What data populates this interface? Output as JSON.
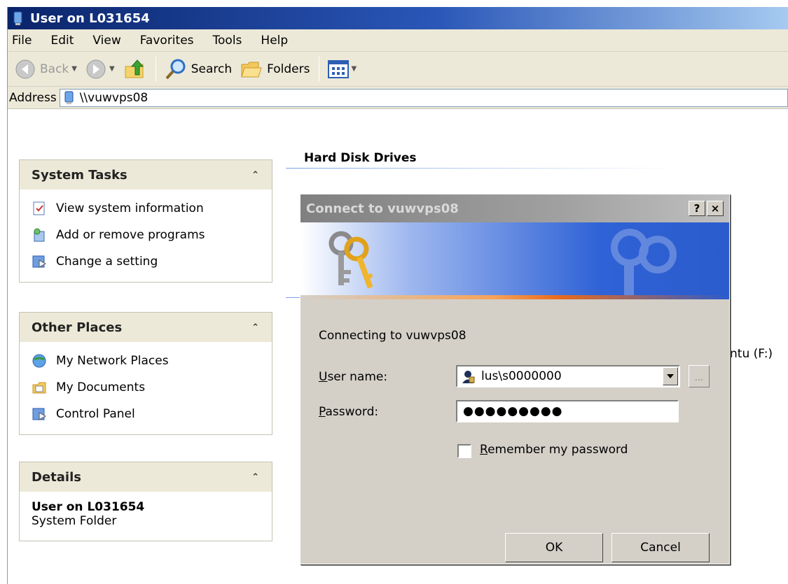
{
  "window": {
    "title": "User on L031654"
  },
  "menu": [
    "File",
    "Edit",
    "View",
    "Favorites",
    "Tools",
    "Help"
  ],
  "toolbar": {
    "back": "Back",
    "search": "Search",
    "folders": "Folders"
  },
  "address": {
    "label": "Address",
    "value": "\\\\vuwvps08"
  },
  "task_pane": {
    "system_tasks": {
      "title": "System Tasks",
      "items": [
        "View system information",
        "Add or remove programs",
        "Change a setting"
      ]
    },
    "other_places": {
      "title": "Other Places",
      "items": [
        "My Network Places",
        "My Documents",
        "Control Panel"
      ]
    },
    "details": {
      "title": "Details",
      "name": "User on L031654",
      "type": "System Folder"
    }
  },
  "content": {
    "section_heading": "Hard Disk Drives",
    "partial_item_label": "ntu (F:)"
  },
  "dialog": {
    "title": "Connect to vuwvps08",
    "help_button": "?",
    "close_button": "×",
    "connecting_text": "Connecting to vuwvps08",
    "user_label_u": "U",
    "user_label_rest": "ser name:",
    "user_value": "lus\\s0000000",
    "password_label_u": "P",
    "password_label_rest": "assword:",
    "password_value": "●●●●●●●●●",
    "remember_u": "R",
    "remember_rest": "emember my password",
    "remember_checked": false,
    "browse_label": "...",
    "ok_label": "OK",
    "cancel_label": "Cancel"
  },
  "colors": {
    "title_bar": "#0a246a",
    "inactive_title": "#808080",
    "banner_blue": "#2b5ccc",
    "banner_orange": "#e96b1c",
    "face": "#d4d0c8",
    "panel_header": "#ece9d8"
  }
}
